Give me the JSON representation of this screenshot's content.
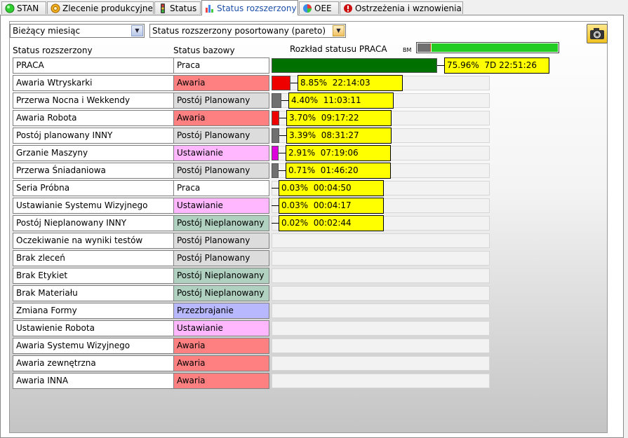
{
  "tabs": [
    {
      "label": "STAN",
      "icon": "green-circle-icon",
      "active": false
    },
    {
      "label": "Zlecenie produkcyjne",
      "icon": "gear-icon",
      "active": false
    },
    {
      "label": "Status",
      "icon": "traffic-light-icon",
      "active": false
    },
    {
      "label": "Status rozszerzony",
      "icon": "bar-chart-icon",
      "active": true
    },
    {
      "label": "OEE",
      "icon": "pie-chart-icon",
      "active": false
    },
    {
      "label": "Ostrzeżenia i wznowienia",
      "icon": "warning-icon",
      "active": false
    }
  ],
  "filters": {
    "period": "Bieżący miesiąc",
    "view": "Status rozszerzony posortowany (pareto)"
  },
  "headers": {
    "extended": "Status rozszerzony",
    "base": "Status bazowy",
    "distribution": "Rozkład statusu PRACA",
    "bm": "BM"
  },
  "bm_gauge": {
    "fraction": 0.1
  },
  "colors": {
    "Praca": "#ffffff",
    "Awaria": "#ff8080",
    "Postój Planowany": "#dcdcdc",
    "Ustawianie": "#ffb8ff",
    "Postój Nieplanowany": "#b0d0c0",
    "Przezbrajanie": "#b8b8ff",
    "bar_praca": "#007000",
    "bar_awaria": "#ee0000",
    "bar_postoj": "#707070",
    "bar_ustawianie": "#dd00dd",
    "label_bg": "#ffff00"
  },
  "rows": [
    {
      "name": "PRACA",
      "base": "Praca",
      "percent": 75.96,
      "pct_text": "75.96%",
      "time_text": "7D 22:51:26",
      "bar": "bar_praca"
    },
    {
      "name": "Awaria Wtryskarki",
      "base": "Awaria",
      "percent": 8.85,
      "pct_text": "8.85%",
      "time_text": "22:14:03",
      "bar": "bar_awaria"
    },
    {
      "name": "Przerwa Nocna i Wekkendy",
      "base": "Postój Planowany",
      "percent": 4.4,
      "pct_text": "4.40%",
      "time_text": "11:03:11",
      "bar": "bar_postoj"
    },
    {
      "name": "Awaria Robota",
      "base": "Awaria",
      "percent": 3.7,
      "pct_text": "3.70%",
      "time_text": "09:17:22",
      "bar": "bar_awaria"
    },
    {
      "name": "Postój planowany INNY",
      "base": "Postój Planowany",
      "percent": 3.39,
      "pct_text": "3.39%",
      "time_text": "08:31:27",
      "bar": "bar_postoj"
    },
    {
      "name": "Grzanie Maszyny",
      "base": "Ustawianie",
      "percent": 2.91,
      "pct_text": "2.91%",
      "time_text": "07:19:06",
      "bar": "bar_ustawianie"
    },
    {
      "name": "Przerwa Śniadaniowa",
      "base": "Postój Planowany",
      "percent": 0.71,
      "pct_text": "0.71%",
      "time_text": "01:46:20",
      "bar": "bar_postoj"
    },
    {
      "name": "Seria Próbna",
      "base": "Praca",
      "percent": 0.03,
      "pct_text": "0.03%",
      "time_text": "00:04:50",
      "bar": "bar_praca"
    },
    {
      "name": "Ustawianie Systemu Wizyjnego",
      "base": "Ustawianie",
      "percent": 0.03,
      "pct_text": "0.03%",
      "time_text": "00:04:17",
      "bar": "bar_ustawianie"
    },
    {
      "name": "Postój Nieplanowany INNY",
      "base": "Postój Nieplanowany",
      "percent": 0.02,
      "pct_text": "0.02%",
      "time_text": "00:02:44",
      "bar": "bar_postoj"
    },
    {
      "name": "Oczekiwanie na wyniki testów",
      "base": "Postój Planowany"
    },
    {
      "name": "Brak zleceń",
      "base": "Postój Planowany"
    },
    {
      "name": "Brak Etykiet",
      "base": "Postój Nieplanowany"
    },
    {
      "name": "Brak Materiału",
      "base": "Postój Nieplanowany"
    },
    {
      "name": "Zmiana Formy",
      "base": "Przezbrajanie"
    },
    {
      "name": "Ustawienie Robota",
      "base": "Ustawianie"
    },
    {
      "name": "Awaria Systemu Wizyjnego",
      "base": "Awaria"
    },
    {
      "name": "Awaria zewnętrzna",
      "base": "Awaria"
    },
    {
      "name": "Awaria INNA",
      "base": "Awaria"
    }
  ]
}
